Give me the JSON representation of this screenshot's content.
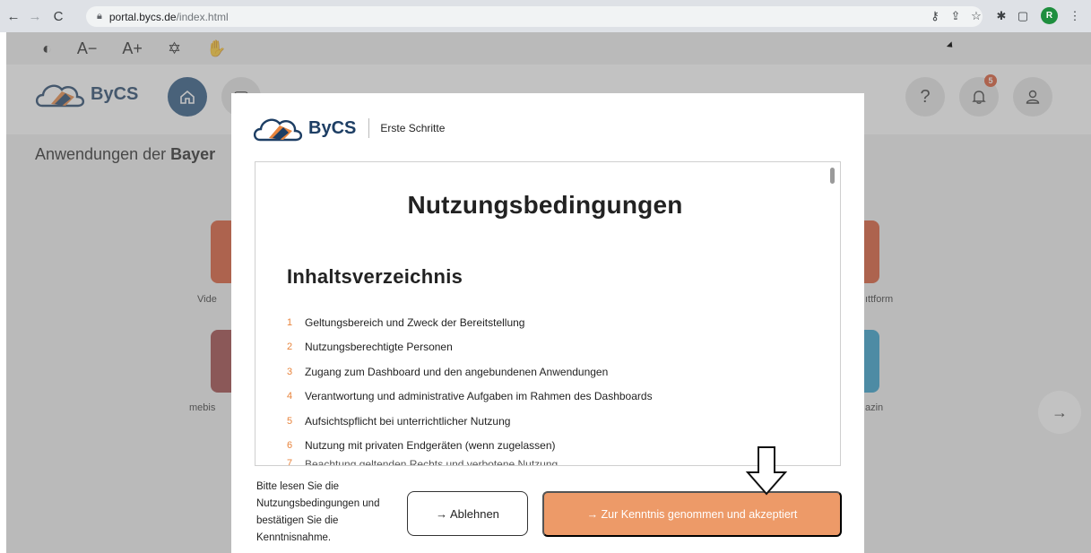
{
  "browser": {
    "url_host": "portal.bycs.de",
    "url_path": "/index.html",
    "profile_initial": "R"
  },
  "accessibility_bar": {
    "contrast_icon": "◐",
    "font_decrease": "A−",
    "font_increase": "A+",
    "sign_language_icon": "✡",
    "hand_icon": "✋"
  },
  "header": {
    "logo_text": "ByCS",
    "notification_count": "5",
    "help_label": "?"
  },
  "page": {
    "heading_prefix": "Anwendungen der ",
    "heading_bold": "Bayer",
    "tile_labels": [
      "Vide",
      "mebis",
      "ıttform",
      "azin"
    ]
  },
  "modal": {
    "logo_text": "ByCS",
    "subtitle": "Erste Schritte",
    "title": "Nutzungsbedingungen",
    "toc_title": "Inhaltsverzeichnis",
    "toc": [
      {
        "num": "1",
        "label": "Geltungsbereich und Zweck der Bereitstellung"
      },
      {
        "num": "2",
        "label": "Nutzungsberechtigte Personen"
      },
      {
        "num": "3",
        "label": "Zugang zum Dashboard und den angebundenen Anwendungen"
      },
      {
        "num": "4",
        "label": "Verantwortung und administrative Aufgaben im Rahmen des Dashboards"
      },
      {
        "num": "5",
        "label": "Aufsichtspflicht bei unterrichtlicher Nutzung"
      },
      {
        "num": "6",
        "label": "Nutzung mit privaten Endgeräten (wenn zugelassen)"
      },
      {
        "num": "7",
        "label": "Beachtung geltenden Rechts und verbotene Nutzung"
      }
    ],
    "footer_text": "Bitte lesen Sie die Nutzungsbedingungen und bestätigen Sie die Kenntnisnahme.",
    "reject_label": "→ Ablehnen",
    "accept_label": "→ Zur Kenntnis genommen und akzeptiert"
  },
  "colors": {
    "accent_orange": "#ed9a68",
    "toc_number": "#e8843c",
    "brand_blue": "#1d3e64",
    "home_blue": "#24507d"
  }
}
